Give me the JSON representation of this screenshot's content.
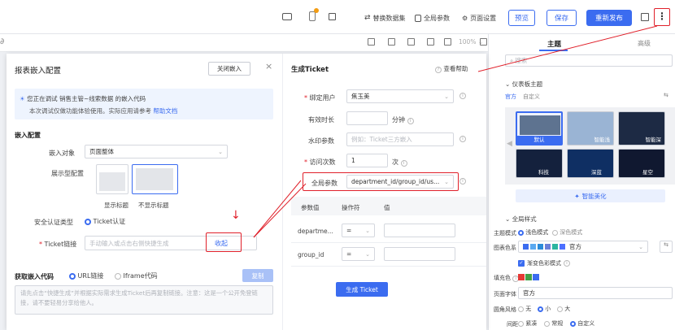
{
  "topbar": {
    "replace_datasource": "替换数据集",
    "global_params": "全局参数",
    "page_settings": "页面设置",
    "preview": "预览",
    "save": "保存",
    "republish": "重新发布"
  },
  "toolbar2": {
    "zoom": "100%"
  },
  "right_panel": {
    "tab_theme": "主题",
    "tab_advanced": "高级",
    "search_placeholder": "搜索",
    "dashboard_theme": "仪表板主题",
    "tab_official": "官方",
    "tab_custom": "自定义",
    "themes": [
      "默认",
      "智能浅",
      "智能深",
      "科技",
      "深蓝",
      "星空"
    ],
    "smart_beautify": "智能美化",
    "global_style": "全局样式",
    "theme_mode_label": "主题模式",
    "mode_light": "浅色模式",
    "mode_dark": "深色模式",
    "chart_colors_label": "图表色系",
    "chart_colors_value": "官方",
    "gradient_label": "渐变色彩模式",
    "fill_label": "填充色",
    "font_label": "页面字体",
    "font_value": "官方",
    "corner_label": "圆角风格",
    "corner_options": [
      "无",
      "小",
      "大"
    ],
    "spacing_label": "间距",
    "spacing_options": [
      "紧凑",
      "常规",
      "自定义"
    ],
    "colors": {
      "fill1": "#e53935",
      "fill2": "#43a047",
      "fill3": "#3b6cf0"
    }
  },
  "embed": {
    "title": "报表嵌入配置",
    "close_embed": "关闭嵌入",
    "notice_line1": "您正在调试 销售主管~线索数据 的嵌入代码",
    "notice_line2_prefix": "本次调试仅做功能体验使用。实际应用请参考",
    "help_doc": "帮助文档",
    "section_config": "嵌入配置",
    "embed_object_label": "嵌入对象",
    "embed_object_value": "页面整体",
    "display_type_label": "展示型配置",
    "show_title": "显示标题",
    "hide_title": "不显示标题",
    "auth_type_label": "安全认证类型",
    "auth_type_value": "Ticket认证",
    "ticket_link_label": "Ticket链接",
    "ticket_link_placeholder": "手动输入或点击右侧快捷生成",
    "collapse": "收起",
    "get_code": "获取嵌入代码",
    "url_link": "URL链接",
    "iframe_code": "Iframe代码",
    "copy": "复制",
    "code_placeholder": "请先点击“快捷生成”并根据实际需求生成Ticket后再复制链接。注意：这是一个公开免登链接，请不要轻易分享给他人。"
  },
  "ticket": {
    "title": "生成Ticket",
    "help": "查看帮助",
    "bind_user_label": "绑定用户",
    "bind_user_value": "焦玉美",
    "valid_time_label": "有效时长",
    "valid_time_unit": "分钟",
    "watermark_label": "水印参数",
    "watermark_placeholder": "例如：Ticket三方嵌入",
    "visits_label": "访问次数",
    "visits_value": "1",
    "visits_unit": "次",
    "global_params_label": "全局参数",
    "global_params_value": "department_id/group_id/us...",
    "col_param_value": "参数值",
    "col_operator": "操作符",
    "col_value": "值",
    "rows": [
      {
        "name": "departme...",
        "op": "="
      },
      {
        "name": "group_id",
        "op": "="
      }
    ],
    "generate": "生成 Ticket"
  },
  "arrow": "↓"
}
